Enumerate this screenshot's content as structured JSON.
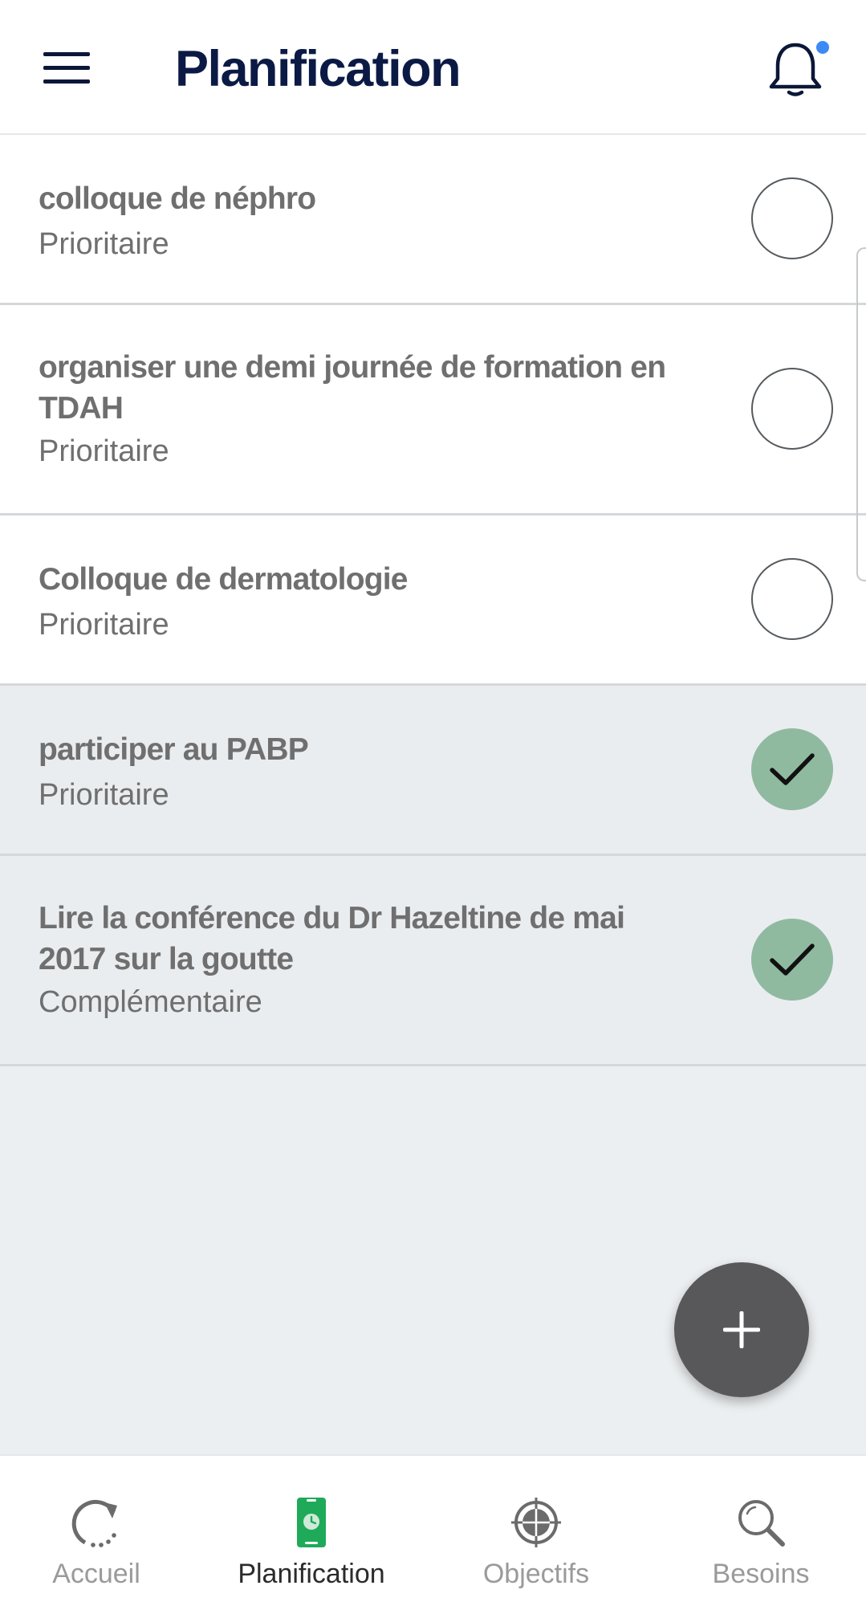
{
  "app": {
    "title": "Planification"
  },
  "colors": {
    "title": "#0b1a45",
    "notification_dot": "#3b8af5",
    "check_done": "#8fbaa0",
    "row_active_bg": "#ffffff",
    "row_done_bg": "#eaedf0",
    "tab_active_text": "#2b2b2b",
    "tab_inactive_text": "#9a9a9a",
    "tab_active_icon": "#1faa59"
  },
  "header": {
    "menu_icon": "hamburger-menu-icon",
    "notification_icon": "bell-icon",
    "has_notification": true
  },
  "tasks": [
    {
      "title": "colloque de néphro",
      "priority": "Prioritaire",
      "done": false
    },
    {
      "title": "organiser une demi journée de formation en TDAH",
      "priority": "Prioritaire",
      "done": false
    },
    {
      "title": "Colloque de dermatologie",
      "priority": "Prioritaire",
      "done": false
    },
    {
      "title": "participer au PABP",
      "priority": "Prioritaire",
      "done": true
    },
    {
      "title": "Lire la conférence du Dr Hazeltine de mai 2017 sur la goutte",
      "priority": "Complémentaire",
      "done": true
    }
  ],
  "fab": {
    "icon": "plus-icon"
  },
  "tabs": [
    {
      "label": "Accueil",
      "icon": "refresh-dots-icon",
      "active": false
    },
    {
      "label": "Planification",
      "icon": "phone-clock-icon",
      "active": true
    },
    {
      "label": "Objectifs",
      "icon": "target-icon",
      "active": false
    },
    {
      "label": "Besoins",
      "icon": "search-icon",
      "active": false
    }
  ]
}
